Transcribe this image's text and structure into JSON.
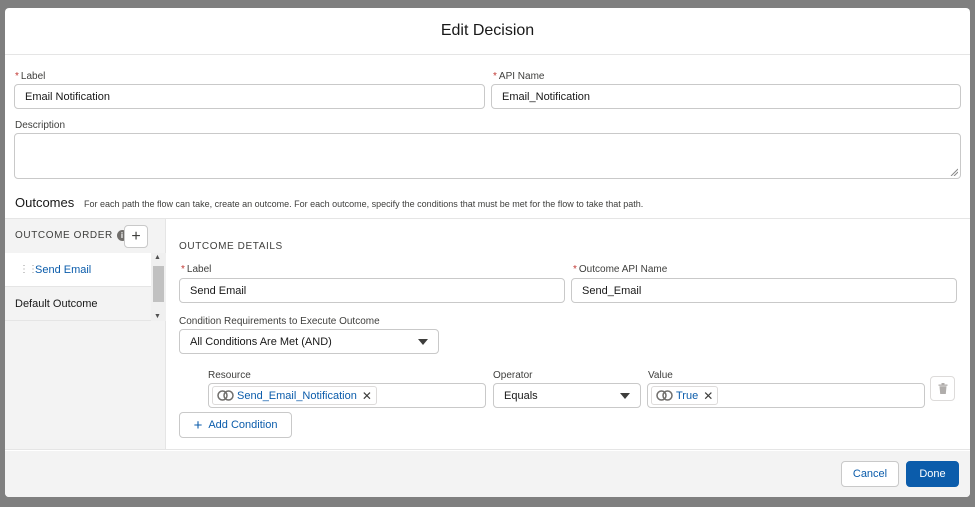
{
  "modal": {
    "title": "Edit Decision"
  },
  "form": {
    "required_marker": "*",
    "label_label": "Label",
    "label_value": "Email Notification",
    "api_name_label": "API Name",
    "api_name_value": "Email_Notification",
    "description_label": "Description",
    "description_value": ""
  },
  "outcomes": {
    "title": "Outcomes",
    "description": "For each path the flow can take, create an outcome. For each outcome, specify the conditions that must be met for the flow to take that path.",
    "order_label": "OUTCOME ORDER",
    "info_icon": "i",
    "add_icon": "+",
    "items": [
      {
        "label": "Send Email",
        "active": true
      },
      {
        "label": "Default Outcome",
        "active": false
      }
    ]
  },
  "details": {
    "heading": "OUTCOME DETAILS",
    "label_label": "Label",
    "label_value": "Send Email",
    "api_name_label": "Outcome API Name",
    "api_name_value": "Send_Email",
    "condition_req_label": "Condition Requirements to Execute Outcome",
    "condition_req_value": "All Conditions Are Met (AND)",
    "resource_label": "Resource",
    "resource_value": "Send_Email_Notification",
    "operator_label": "Operator",
    "operator_value": "Equals",
    "value_label": "Value",
    "value_value": "True",
    "add_condition_plus": "+",
    "add_condition_label": "Add Condition"
  },
  "footer": {
    "cancel_label": "Cancel",
    "done_label": "Done"
  },
  "colors": {
    "brand": "#0b5cab",
    "required": "#c23934",
    "overlay": "#7f7f7f"
  }
}
